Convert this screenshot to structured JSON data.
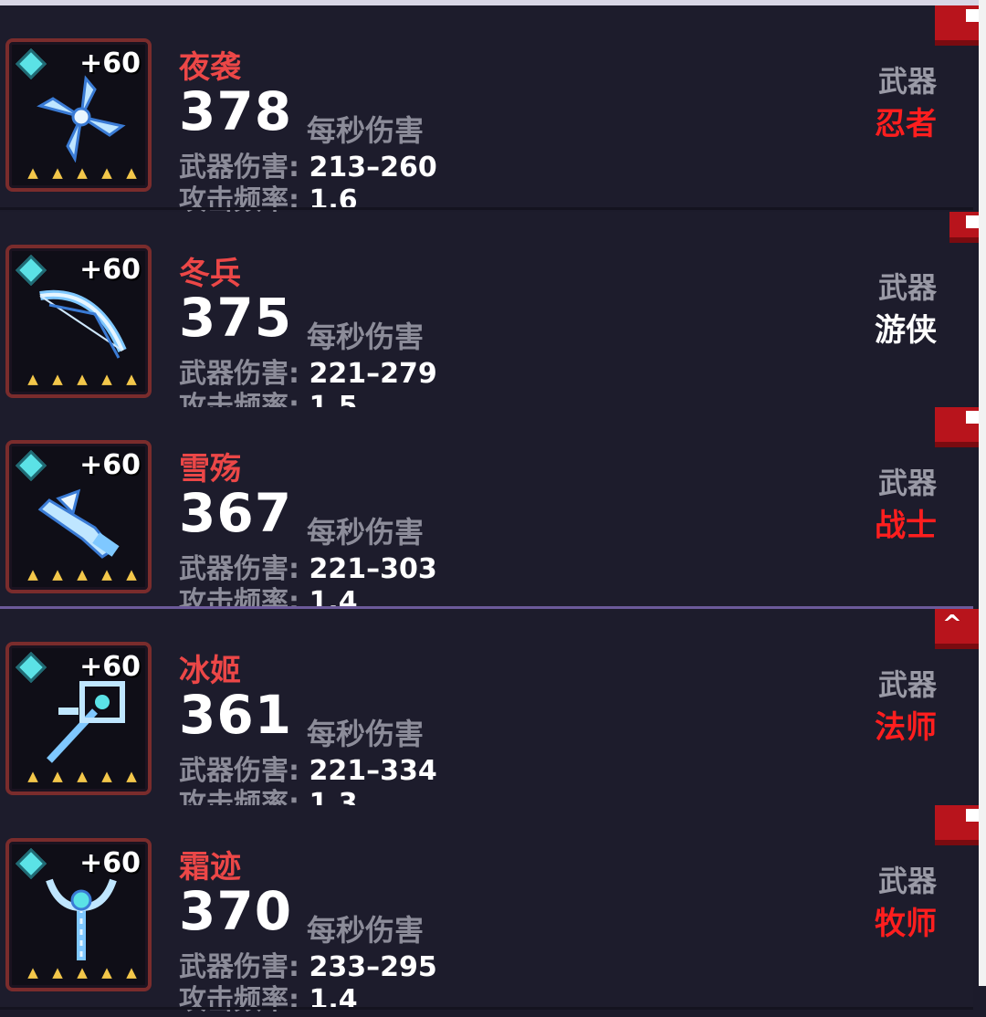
{
  "labels": {
    "dps": "每秒伤害",
    "weapon_damage": "武器伤害:",
    "attack_rate": "攻击频率:",
    "type": "武器"
  },
  "colors": {
    "name": "#ec4747",
    "class_red": "#ff1e1e",
    "class_white": "#ffffff",
    "star": "#f3c74a",
    "gem": "#5be2e6"
  },
  "weapons": [
    {
      "name": "夜袭",
      "dps": "378",
      "plus": "+60",
      "damage": "213–260",
      "rate": "1.6",
      "class": "忍者",
      "class_color": "#ff1e1e",
      "icon": "shuriken-icon",
      "stars": 5
    },
    {
      "name": "冬兵",
      "dps": "375",
      "plus": "+60",
      "damage": "221–279",
      "rate": "1.5",
      "class": "游侠",
      "class_color": "#ffffff",
      "icon": "bow-icon",
      "stars": 5
    },
    {
      "name": "雪殇",
      "dps": "367",
      "plus": "+60",
      "damage": "221–303",
      "rate": "1.4",
      "class": "战士",
      "class_color": "#ff1e1e",
      "icon": "sword-icon",
      "stars": 5
    },
    {
      "name": "冰姬",
      "dps": "361",
      "plus": "+60",
      "damage": "221–334",
      "rate": "1.3",
      "class": "法师",
      "class_color": "#ff1e1e",
      "icon": "staff-icon",
      "stars": 5
    },
    {
      "name": "霜迹",
      "dps": "370",
      "plus": "+60",
      "damage": "233–295",
      "rate": "1.4",
      "class": "牧师",
      "class_color": "#ff1e1e",
      "icon": "scepter-icon",
      "stars": 5
    }
  ]
}
